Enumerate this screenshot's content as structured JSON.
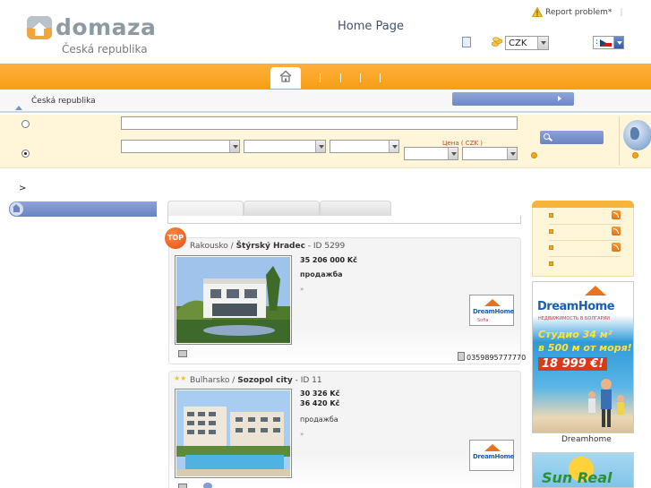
{
  "header": {
    "brand": "domaza",
    "country": "Česká republika",
    "page_title": "Home Page",
    "report_problem": "Report problem*",
    "report_sep": "|",
    "currency": "CZK",
    "language": ":"
  },
  "breadcrumb": {
    "location": "Česká republika",
    "arrow": ">"
  },
  "search": {
    "price_label": "Цена ( CZK )"
  },
  "listings": [
    {
      "badge": "TOP",
      "country": "Rakousko",
      "slash": "/",
      "city": "Štýrský Hradec",
      "id": "- ID 5299",
      "price": "35 206 000 Kč",
      "deal_type": "продажба",
      "bullet": "»",
      "agency": "DreamHome",
      "agency_sub": "Sofia",
      "phone": "0359895777770"
    },
    {
      "country": "Bulharsko",
      "slash": "/",
      "city": "Sozopol city",
      "id": "- ID 11",
      "price": "30 326 Kč",
      "price2": "36 420 Kč",
      "deal_type": "продажба",
      "bullet": "»",
      "agency": "DreamHome"
    }
  ],
  "banners": {
    "dreamhome_title": "DreamHome",
    "dreamhome_sub": "НЕДВИЖИМОСТЬ В БОЛГАРИИ",
    "promo_line1": "Студио 34 м²",
    "promo_line2": "в 500 м от моря!",
    "promo_price": "18 999 €!",
    "caption": "Dreamhome",
    "sunreal": "Sun Real"
  },
  "colors": {
    "accent_orange": "#f79d16",
    "nav_blue": "#6b83c0",
    "panel_cream": "#fff5d8",
    "price_red": "#c6452c"
  },
  "icons": [
    "logo-icon",
    "warning-icon",
    "document-icon",
    "coins-icon",
    "flag-cz-icon",
    "home-icon",
    "search-icon",
    "globe-icon",
    "rss-icon",
    "camera-icon",
    "phone-icon",
    "star-icon"
  ]
}
